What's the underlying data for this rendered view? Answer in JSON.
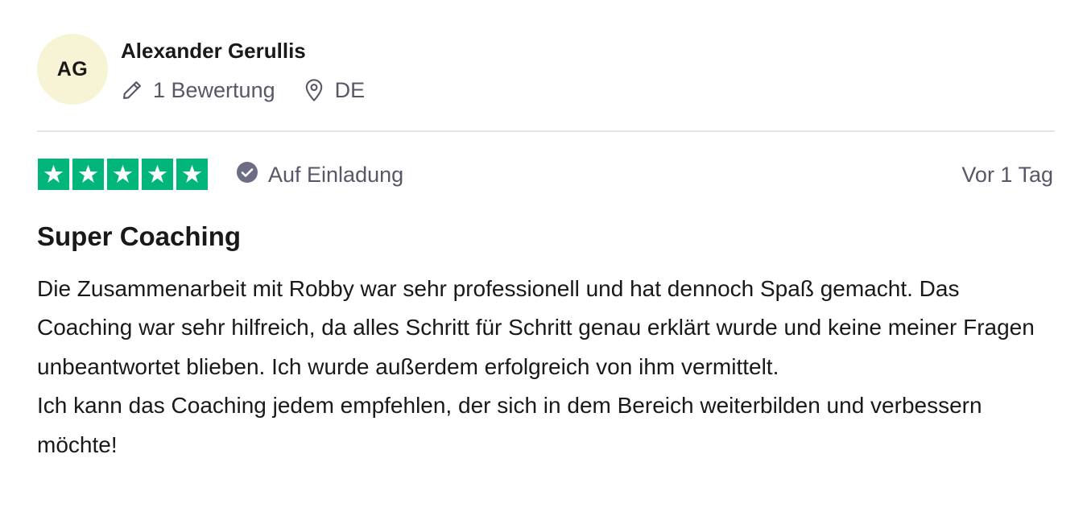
{
  "consumer": {
    "initials": "AG",
    "name": "Alexander Gerullis",
    "review_count": "1 Bewertung",
    "country": "DE",
    "icons": {
      "review_count": "pencil-icon",
      "country": "location-pin-icon"
    }
  },
  "review": {
    "rating": 5,
    "rating_max": 5,
    "invite_label": "Auf Einladung",
    "invite_icon": "verified-check-icon",
    "date": "Vor 1 Tag",
    "title": "Super Coaching",
    "body_paragraphs": [
      "Die Zusammenarbeit mit Robby war sehr professionell und hat dennoch Spaß gemacht. Das Coaching war sehr hilfreich, da alles Schritt für Schritt genau erklärt wurde und keine meiner Fragen unbeantwortet blieben. Ich wurde außerdem erfolgreich von ihm vermittelt.",
      "Ich kann das Coaching jedem empfehlen, der sich in dem Bereich weiterbilden und verbessern möchte!"
    ]
  },
  "colors": {
    "star_green": "#00b67a",
    "avatar_bg": "#f7f4d5",
    "muted_text": "#575768",
    "divider": "#e5e5dd",
    "text": "#191919"
  }
}
